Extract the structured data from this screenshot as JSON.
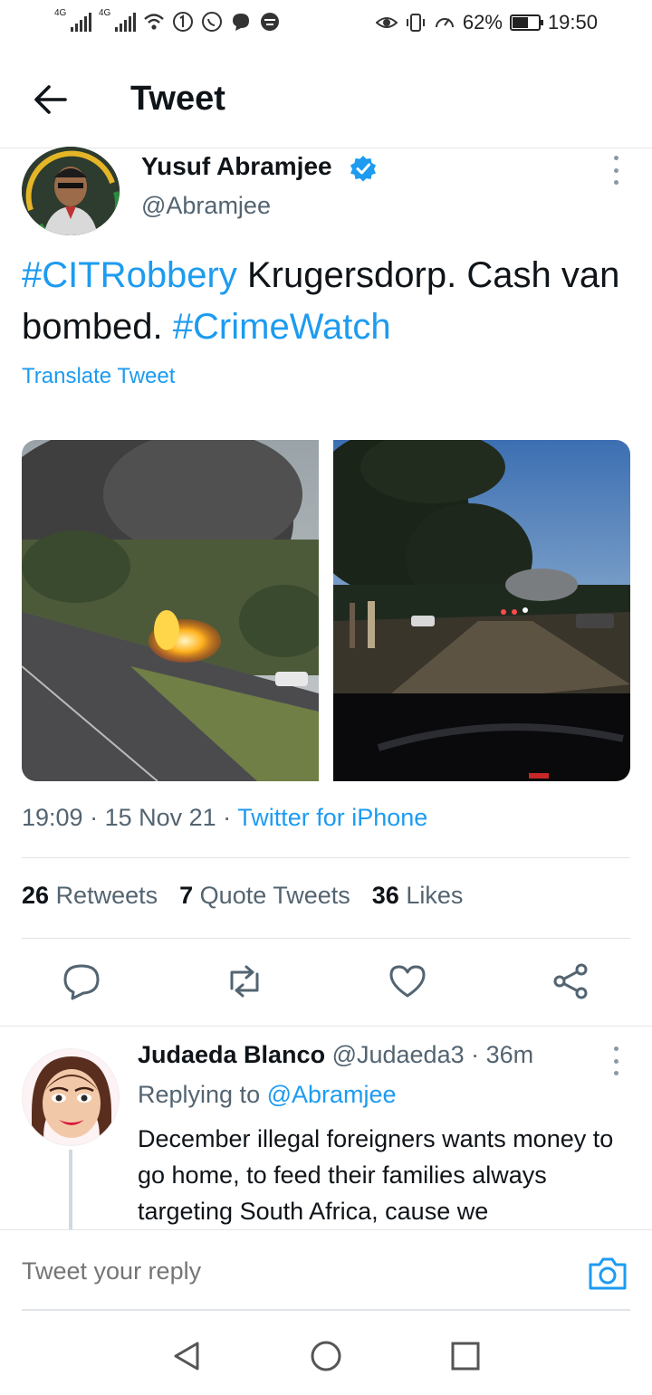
{
  "status_bar": {
    "network1": "4G",
    "network2": "4G",
    "battery_text": "62%",
    "battery_level": 0.62,
    "time": "19:50"
  },
  "header": {
    "title": "Tweet"
  },
  "tweet": {
    "author_name": "Yusuf Abramjee",
    "author_handle": "@Abramjee",
    "text_parts": {
      "hashtag1": "#CITRobbery",
      "plain": " Krugersdorp. Cash van bombed. ",
      "hashtag2": "#CrimeWatch"
    },
    "translate_label": "Translate Tweet",
    "time": "19:09",
    "date": "15 Nov 21",
    "source": "Twitter for iPhone",
    "stats": {
      "retweets_count": "26",
      "retweets_label": "Retweets",
      "quotes_count": "7",
      "quotes_label": "Quote Tweets",
      "likes_count": "36",
      "likes_label": "Likes"
    }
  },
  "reply": {
    "name": "Judaeda Blanco",
    "handle": "@Judaeda3",
    "age": "36m",
    "replying_prefix": "Replying to",
    "replying_to": "@Abramjee",
    "text": "December illegal  foreigners wants money to go home, to feed their families always targeting South Africa, cause we"
  },
  "compose": {
    "placeholder": "Tweet your reply"
  },
  "colors": {
    "accent": "#1d9bf0",
    "text": "#0f1419",
    "secondary": "#536471"
  }
}
